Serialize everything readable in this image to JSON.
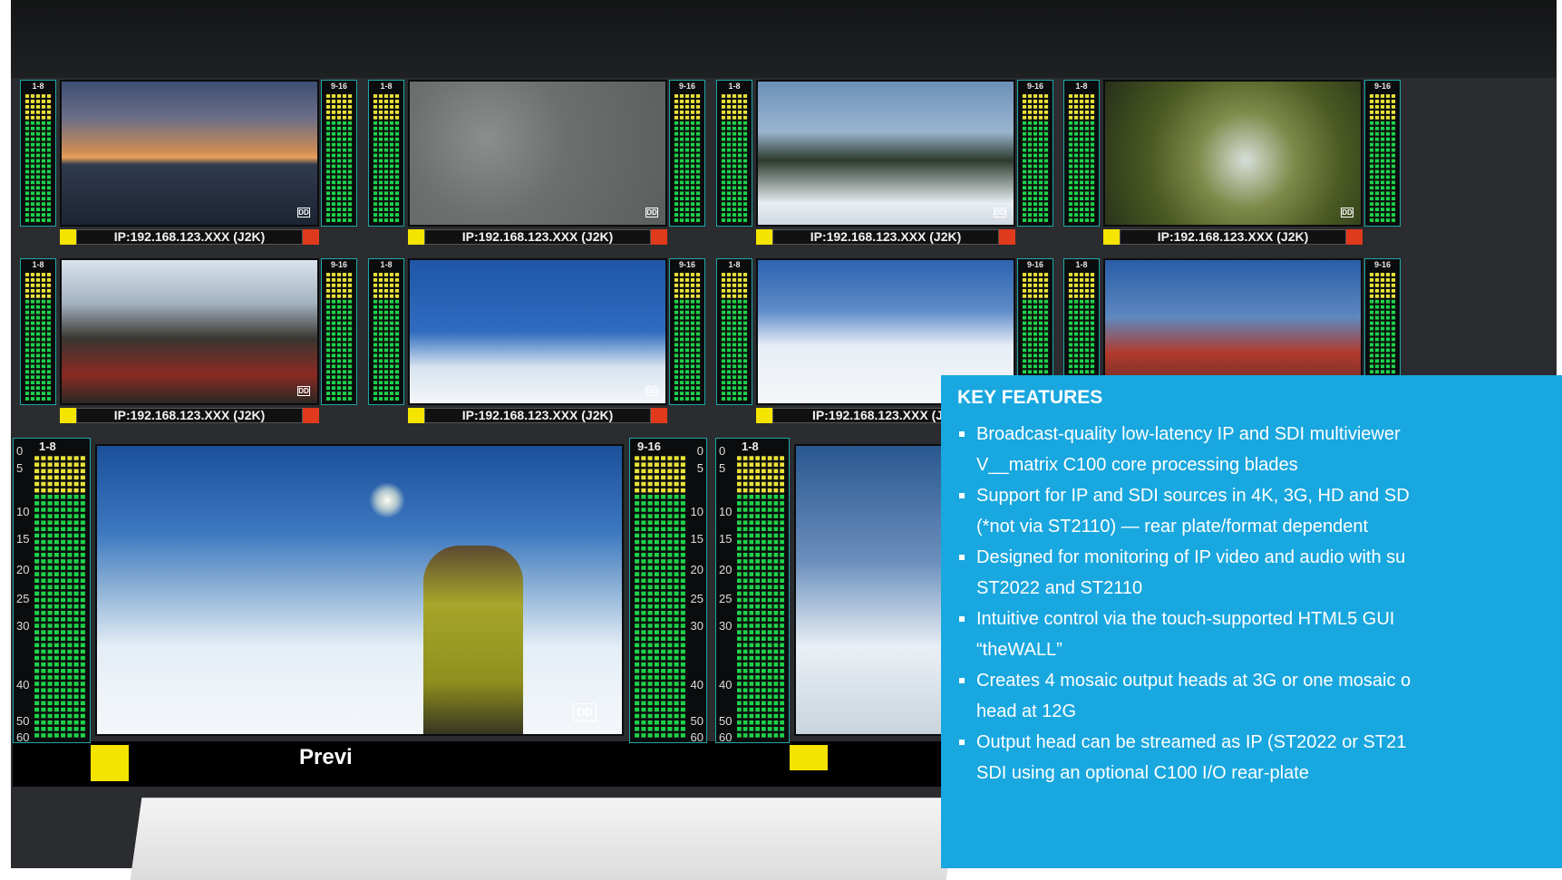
{
  "panel": {
    "title": "KEY FEATURES",
    "features": [
      {
        "line1": "Broadcast-quality low-latency IP and SDI multiviewer",
        "line2": "V__matrix C100 core processing blades"
      },
      {
        "line1": "Support for IP and SDI sources in 4K, 3G, HD and SD",
        "line2": "(*not via ST2110) — rear plate/format dependent"
      },
      {
        "line1": "Designed for monitoring of IP video and audio with su",
        "line2": "ST2022 and ST2110"
      },
      {
        "line1": "Intuitive control via the touch-supported HTML5 GUI",
        "line2": "“theWALL”"
      },
      {
        "line1": "Creates 4 mosaic output heads at 3G or one mosaic o",
        "line2": "head at 12G"
      },
      {
        "line1": "Output head can be streamed as IP (ST2022 or ST21",
        "line2": "SDI using an optional C100 I/O rear-plate"
      }
    ]
  },
  "tiles": [
    {
      "label": "IP:192.168.123.XXX (J2K)",
      "meter_left": "1-8",
      "meter_right": "9-16",
      "scene": "sunset-sailboat"
    },
    {
      "label": "IP:192.168.123.XXX (J2K)",
      "meter_left": "1-8",
      "meter_right": "9-16",
      "scene": "snow-texture"
    },
    {
      "label": "IP:192.168.123.XXX (J2K)",
      "meter_left": "1-8",
      "meter_right": "9-16",
      "scene": "snowy-trees"
    },
    {
      "label": "IP:192.168.123.XXX (J2K)",
      "meter_left": "1-8",
      "meter_right": "9-16",
      "scene": "pine-branch"
    },
    {
      "label": "IP:192.168.123.XXX (J2K)",
      "meter_left": "1-8",
      "meter_right": "9-16",
      "scene": "skier-portrait"
    },
    {
      "label": "IP:192.168.123.XXX (J2K)",
      "meter_left": "1-8",
      "meter_right": "9-16",
      "scene": "snowboarders-group"
    },
    {
      "label": "IP:192.168.123.XXX (J2K",
      "meter_left": "1-8",
      "meter_right": "9-16",
      "scene": "snowboarder-jump"
    },
    {
      "label": "",
      "meter_left": "1-8",
      "meter_right": "9-16",
      "scene": "high-five"
    }
  ],
  "big_meters": {
    "left_label": "1-8",
    "right_label": "9-16",
    "left2_label": "1-8",
    "scale": [
      "0",
      "5",
      "10",
      "15",
      "20",
      "25",
      "30",
      "40",
      "50",
      "60"
    ]
  },
  "preview_label": "Previ",
  "colors": {
    "tally_left": "#f4e400",
    "tally_right": "#e03a1c",
    "meter_border": "#1fa7a9",
    "meter_green": "#1fd24a",
    "meter_yellow": "#e8e23a",
    "panel_bg": "#19a7df"
  }
}
